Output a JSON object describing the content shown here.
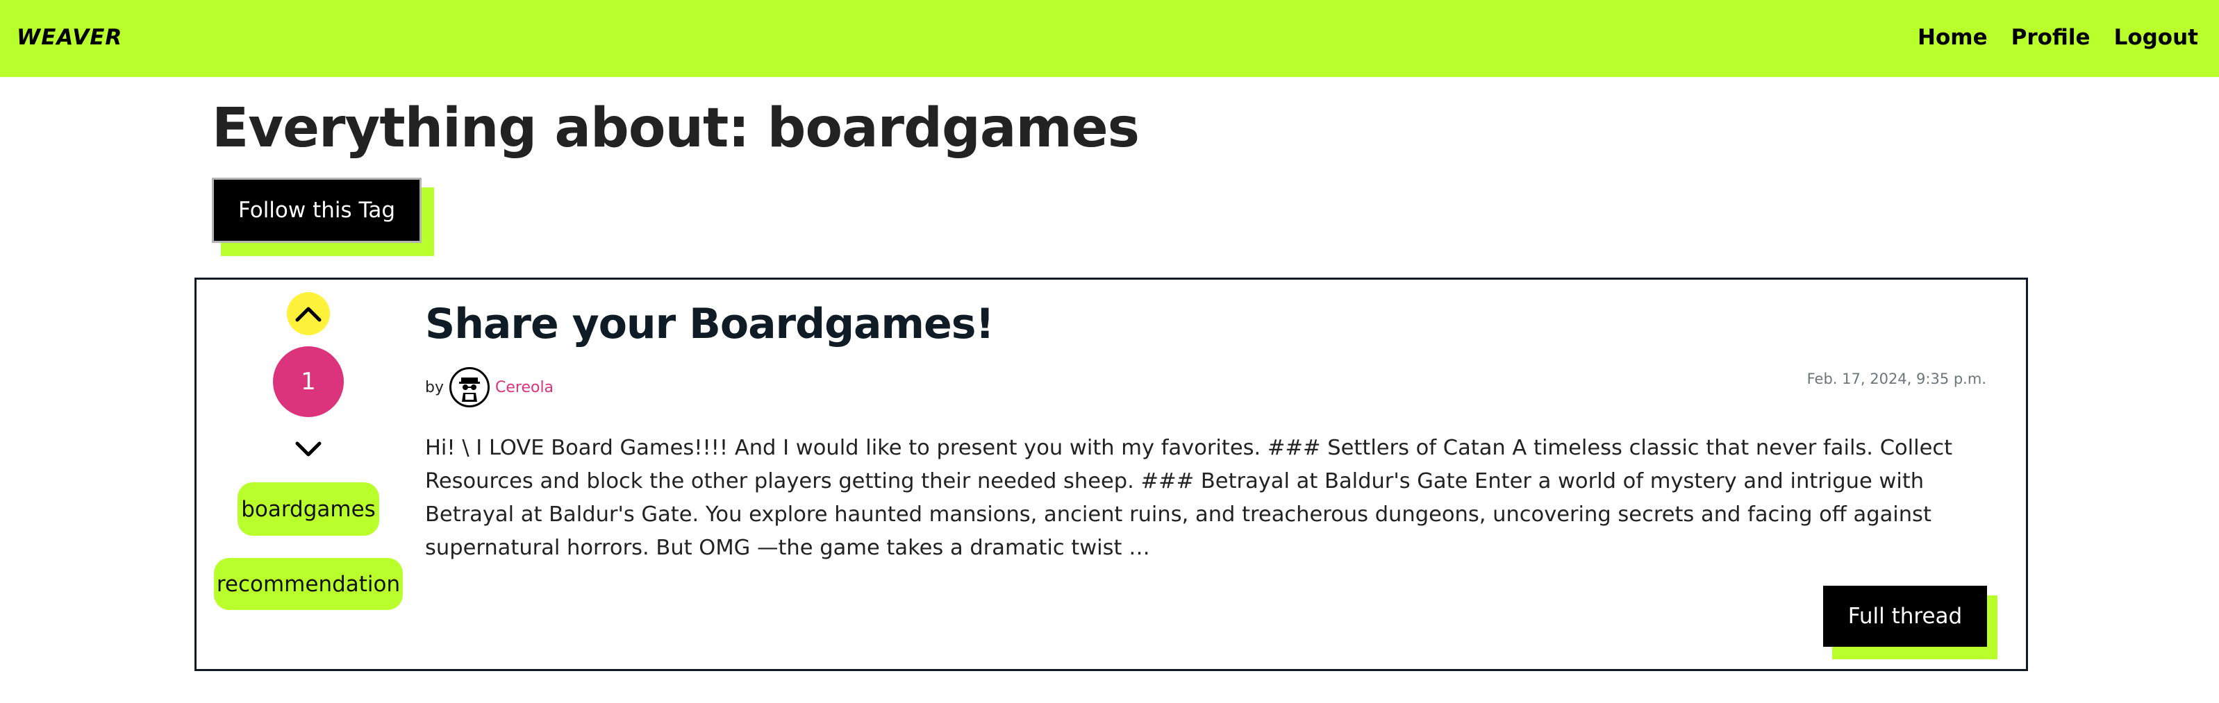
{
  "brand": "WEAVER",
  "nav": {
    "home": "Home",
    "profile": "Profile",
    "logout": "Logout"
  },
  "page": {
    "title": "Everything about: boardgames",
    "follow_label": "Follow this Tag"
  },
  "thread": {
    "score": "1",
    "tags": [
      "boardgames",
      "recommendation"
    ],
    "title": "Share your Boardgames!",
    "by_label": "by",
    "author": "Cereola",
    "date": "Feb. 17, 2024, 9:35 p.m.",
    "excerpt": "Hi! \\ I LOVE Board Games!!!! And I would like to present you with my favorites. ### Settlers of Catan A timeless classic that never fails. Collect Resources and block the other players getting their needed sheep. ### Betrayal at Baldur's Gate Enter a world of mystery and intrigue with Betrayal at Baldur's Gate. You explore haunted mansions, ancient ruins, and treacherous dungeons, uncovering secrets and facing off against supernatural horrors. But OMG —the game takes a dramatic twist …",
    "full_thread_label": "Full thread"
  },
  "icons": {
    "upvote": "chevron-up-icon",
    "downvote": "chevron-down-icon",
    "avatar": "user-avatar-icon"
  },
  "colors": {
    "accent": "#b9ff2b",
    "vote_up": "#fff23a",
    "score_badge": "#db337c",
    "author": "#db337c"
  }
}
